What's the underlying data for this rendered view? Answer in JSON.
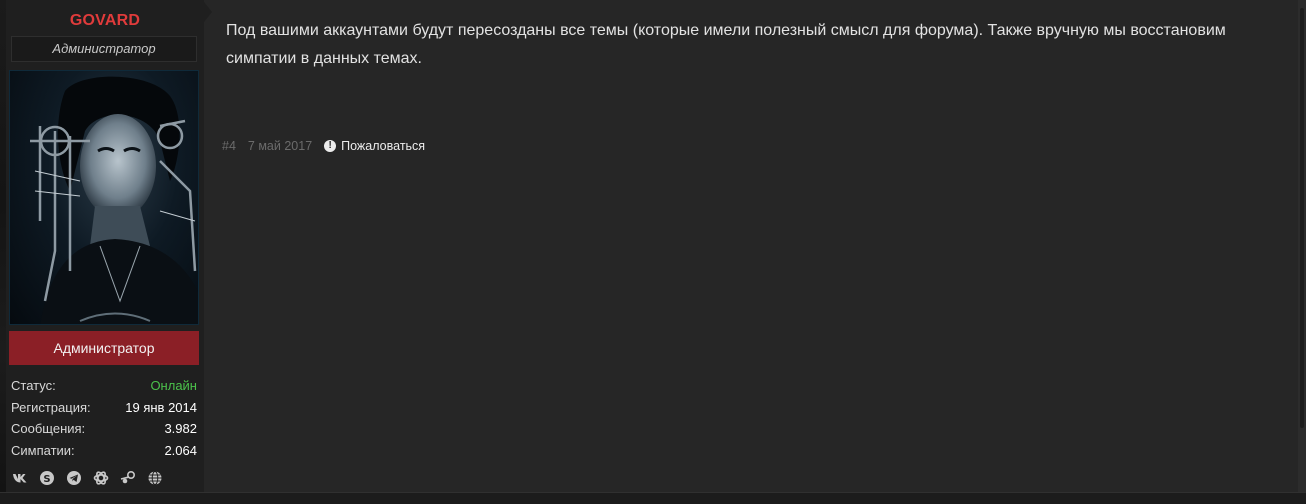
{
  "user": {
    "name": "GOVARD",
    "title": "Администратор",
    "role_banner": "Администратор",
    "stats": [
      {
        "label": "Статус:",
        "value": "Онлайн"
      },
      {
        "label": "Регистрация:",
        "value": "19 янв 2014"
      },
      {
        "label": "Сообщения:",
        "value": "3.982"
      },
      {
        "label": "Симпатии:",
        "value": "2.064"
      }
    ],
    "socials": [
      "vk-icon",
      "skype-icon",
      "telegram-icon",
      "battlenet-icon",
      "steam-icon",
      "website-icon"
    ]
  },
  "post": {
    "message": "Под вашими аккаунтами будут пересозданы все темы (которые имели полезный смысл для форума). Также вручную мы восстановим симпатии в данных темах.",
    "number": "#4",
    "date": "7 май 2017",
    "report_label": "Пожаловаться"
  },
  "colors": {
    "username": "#e03b3b",
    "role_banner": "#8b1f26",
    "online": "#4bc24b",
    "background": "#262626"
  }
}
